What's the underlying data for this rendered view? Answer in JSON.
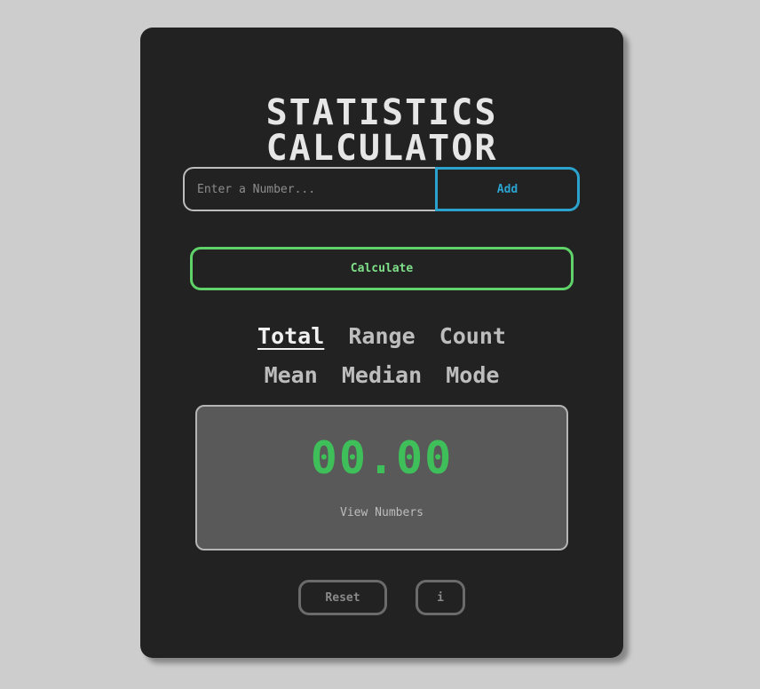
{
  "title": {
    "line1": "STATISTICS",
    "line2": "CALCULATOR"
  },
  "input": {
    "placeholder": "Enter a Number...",
    "value": ""
  },
  "buttons": {
    "add": "Add",
    "calculate": "Calculate",
    "reset": "Reset",
    "info": "i"
  },
  "stats": {
    "row1": [
      "Total",
      "Range",
      "Count"
    ],
    "row2": [
      "Mean",
      "Median",
      "Mode"
    ],
    "active": "Total"
  },
  "display": {
    "result": "00.00",
    "view_numbers": "View Numbers"
  },
  "colors": {
    "page_background": "#cdcdcd",
    "card_background": "#222222",
    "add_accent": "#2ba3cf",
    "calculate_accent": "#5fd26a",
    "result_text": "#3fbf59",
    "display_background": "#595959"
  }
}
